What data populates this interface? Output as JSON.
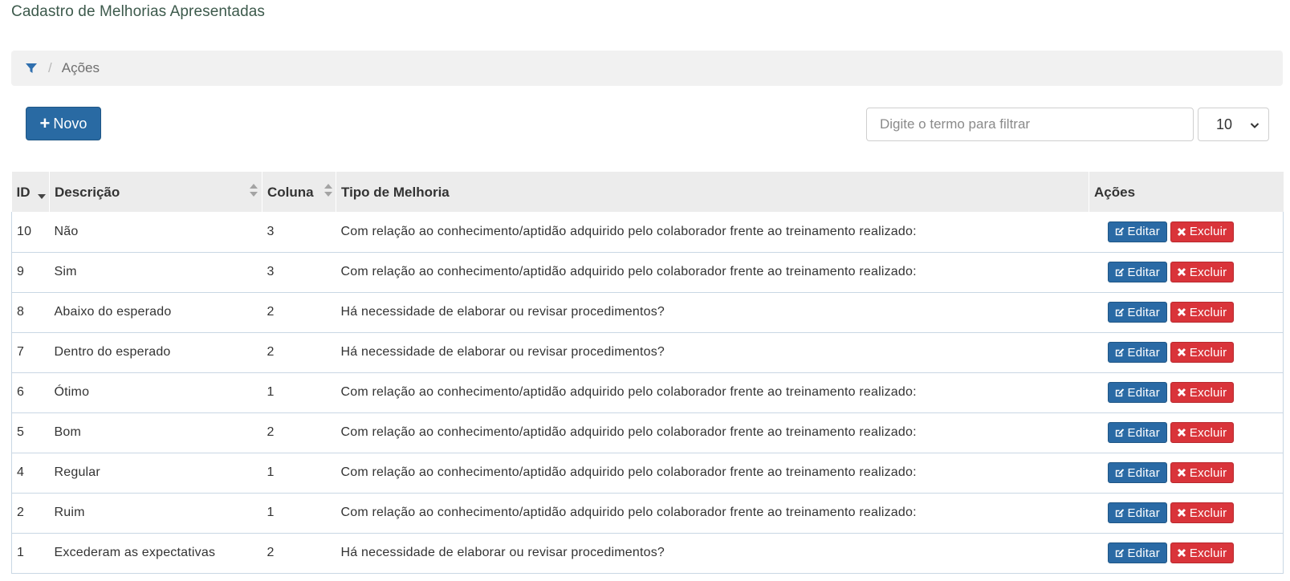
{
  "page": {
    "title": "Cadastro de Melhorias Apresentadas"
  },
  "breadcrumb": {
    "icon": "filter-icon",
    "separator": "/",
    "current": "Ações"
  },
  "toolbar": {
    "new_label": "Novo",
    "new_icon": "plus-icon",
    "filter_placeholder": "Digite o termo para filtrar",
    "filter_value": "",
    "page_size": "10"
  },
  "table": {
    "columns": [
      {
        "label": "ID",
        "sort": "desc"
      },
      {
        "label": "Descrição",
        "sort": "both"
      },
      {
        "label": "Coluna",
        "sort": "both"
      },
      {
        "label": "Tipo de Melhoria",
        "sort": "none"
      },
      {
        "label": "Ações",
        "sort": "none"
      }
    ],
    "edit_label": "Editar",
    "delete_label": "Excluir",
    "rows": [
      {
        "id": "10",
        "descricao": "Não",
        "coluna": "3",
        "tipo": "Com relação ao conhecimento/aptidão adquirido pelo colaborador frente ao treinamento realizado:"
      },
      {
        "id": "9",
        "descricao": "Sim",
        "coluna": "3",
        "tipo": "Com relação ao conhecimento/aptidão adquirido pelo colaborador frente ao treinamento realizado:"
      },
      {
        "id": "8",
        "descricao": "Abaixo do esperado",
        "coluna": "2",
        "tipo": "Há necessidade de elaborar ou revisar procedimentos?"
      },
      {
        "id": "7",
        "descricao": "Dentro do esperado",
        "coluna": "2",
        "tipo": "Há necessidade de elaborar ou revisar procedimentos?"
      },
      {
        "id": "6",
        "descricao": "Ótimo",
        "coluna": "1",
        "tipo": "Com relação ao conhecimento/aptidão adquirido pelo colaborador frente ao treinamento realizado:"
      },
      {
        "id": "5",
        "descricao": "Bom",
        "coluna": "2",
        "tipo": "Com relação ao conhecimento/aptidão adquirido pelo colaborador frente ao treinamento realizado:"
      },
      {
        "id": "4",
        "descricao": "Regular",
        "coluna": "1",
        "tipo": "Com relação ao conhecimento/aptidão adquirido pelo colaborador frente ao treinamento realizado:"
      },
      {
        "id": "2",
        "descricao": "Ruim",
        "coluna": "1",
        "tipo": "Com relação ao conhecimento/aptidão adquirido pelo colaborador frente ao treinamento realizado:"
      },
      {
        "id": "1",
        "descricao": "Excederam as expectativas",
        "coluna": "2",
        "tipo": "Há necessidade de elaborar ou revisar procedimentos?"
      }
    ]
  },
  "colors": {
    "primary": "#296aa3",
    "danger": "#d9343a",
    "title": "#3d5a4c"
  }
}
